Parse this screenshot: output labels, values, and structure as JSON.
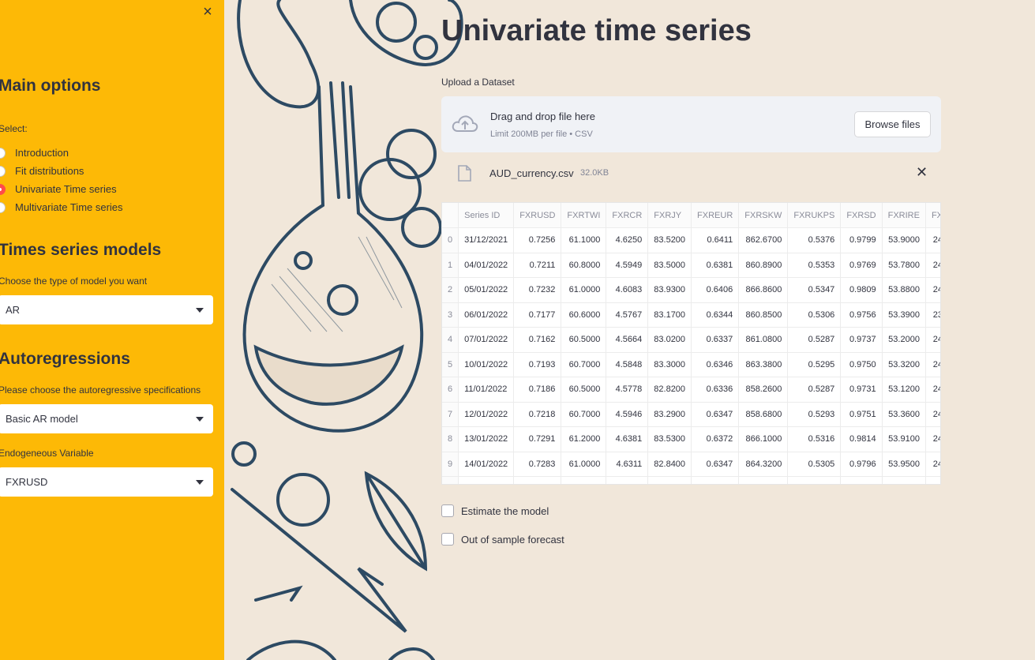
{
  "sidebar": {
    "main_heading": "Main options",
    "select_label": "Select:",
    "radios": [
      {
        "label": "Introduction",
        "selected": false
      },
      {
        "label": "Fit distributions",
        "selected": false
      },
      {
        "label": "Univariate Time series",
        "selected": true
      },
      {
        "label": "Multivariate Time series",
        "selected": false
      }
    ],
    "models_heading": "Times series models",
    "model_label": "Choose the type of model you want",
    "model_value": "AR",
    "auto_heading": "Autoregressions",
    "auto_label": "Please choose the autoregressive specifications",
    "auto_value": "Basic AR model",
    "endog_label": "Endogeneous Variable",
    "endog_value": "FXRUSD",
    "close_glyph": "×"
  },
  "main": {
    "title": "Univariate time series",
    "upload_label": "Upload a Dataset",
    "dropzone_title": "Drag and drop file here",
    "dropzone_sub": "Limit 200MB per file • CSV",
    "browse_label": "Browse files",
    "file_name": "AUD_currency.csv",
    "file_size": "32.0KB",
    "file_close": "✕",
    "check_estimate": "Estimate the model",
    "check_forecast": "Out of sample forecast"
  },
  "table": {
    "columns": [
      "",
      "Series ID",
      "FXRUSD",
      "FXRTWI",
      "FXRCR",
      "FXRJY",
      "FXREUR",
      "FXRSKW",
      "FXRUKPS",
      "FXRSD",
      "FXRIRE",
      "FX"
    ],
    "rows": [
      [
        "0",
        "31/12/2021",
        "0.7256",
        "61.1000",
        "4.6250",
        "83.5200",
        "0.6411",
        "862.6700",
        "0.5376",
        "0.9799",
        "53.9000",
        "24"
      ],
      [
        "1",
        "04/01/2022",
        "0.7211",
        "60.8000",
        "4.5949",
        "83.5000",
        "0.6381",
        "860.8900",
        "0.5353",
        "0.9769",
        "53.7800",
        "24"
      ],
      [
        "2",
        "05/01/2022",
        "0.7232",
        "61.0000",
        "4.6083",
        "83.9300",
        "0.6406",
        "866.8600",
        "0.5347",
        "0.9809",
        "53.8800",
        "24"
      ],
      [
        "3",
        "06/01/2022",
        "0.7177",
        "60.6000",
        "4.5767",
        "83.1700",
        "0.6344",
        "860.8500",
        "0.5306",
        "0.9756",
        "53.3900",
        "23"
      ],
      [
        "4",
        "07/01/2022",
        "0.7162",
        "60.5000",
        "4.5664",
        "83.0200",
        "0.6337",
        "861.0800",
        "0.5287",
        "0.9737",
        "53.2000",
        "24"
      ],
      [
        "5",
        "10/01/2022",
        "0.7193",
        "60.7000",
        "4.5848",
        "83.3000",
        "0.6346",
        "863.3800",
        "0.5295",
        "0.9750",
        "53.3200",
        "24"
      ],
      [
        "6",
        "11/01/2022",
        "0.7186",
        "60.5000",
        "4.5778",
        "82.8200",
        "0.6336",
        "858.2600",
        "0.5287",
        "0.9731",
        "53.1200",
        "24"
      ],
      [
        "7",
        "12/01/2022",
        "0.7218",
        "60.7000",
        "4.5946",
        "83.2900",
        "0.6347",
        "858.6800",
        "0.5293",
        "0.9751",
        "53.3600",
        "24"
      ],
      [
        "8",
        "13/01/2022",
        "0.7291",
        "61.2000",
        "4.6381",
        "83.5300",
        "0.6372",
        "866.1000",
        "0.5316",
        "0.9814",
        "53.9100",
        "24"
      ],
      [
        "9",
        "14/01/2022",
        "0.7283",
        "61.0000",
        "4.6311",
        "82.8400",
        "0.6347",
        "864.3200",
        "0.5305",
        "0.9796",
        "53.9500",
        "24"
      ]
    ]
  },
  "colors": {
    "sidebar_bg": "#fdb906",
    "page_bg": "#f1e7da",
    "accent_radio": "#ff4b4b",
    "text": "#31333f",
    "art_stroke": "#2d4a63"
  },
  "icons": {
    "upload": "cloud-upload-icon",
    "file": "file-icon",
    "close": "close-icon",
    "dropdown": "chevron-down-icon"
  }
}
